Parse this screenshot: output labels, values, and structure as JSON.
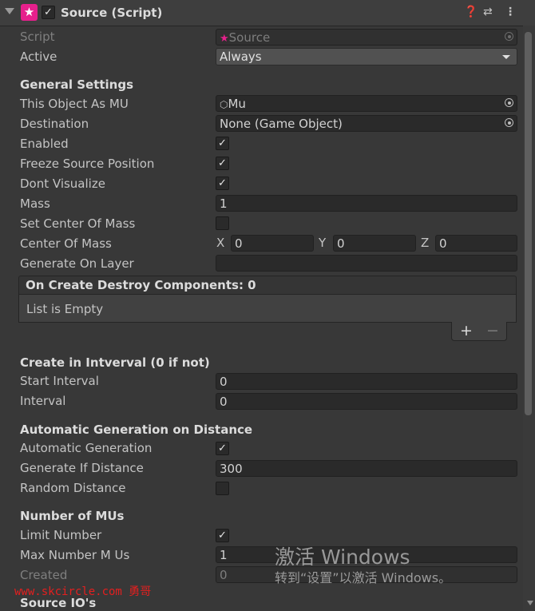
{
  "header": {
    "title": "Source (Script)",
    "enabled": true,
    "icons": [
      "help-icon",
      "preset-icon",
      "kebab-menu-icon"
    ]
  },
  "fields": {
    "script_label": "Script",
    "script_value": "Source",
    "active_label": "Active",
    "active_value": "Always",
    "general_settings": "General Settings",
    "this_object_label": "This Object As MU",
    "this_object_value": "Mu",
    "destination_label": "Destination",
    "destination_value": "None (Game Object)",
    "enabled_label": "Enabled",
    "enabled": true,
    "freeze_label": "Freeze Source Position",
    "freeze": true,
    "dont_visualize_label": "Dont Visualize",
    "dont_visualize": true,
    "mass_label": "Mass",
    "mass_value": "1",
    "set_com_label": "Set Center Of Mass",
    "set_com": false,
    "com_label": "Center Of Mass",
    "com_x_label": "X",
    "com_x": "0",
    "com_y_label": "Y",
    "com_y": "0",
    "com_z_label": "Z",
    "com_z": "0",
    "layer_label": "Generate On Layer",
    "layer_value": ""
  },
  "list": {
    "title": "On Create Destroy Components: 0",
    "empty": "List is Empty",
    "add": "+",
    "remove": "−"
  },
  "interval": {
    "section": "Create in Intverval (0 if not)",
    "start_label": "Start Interval",
    "start_value": "0",
    "interval_label": "Interval",
    "interval_value": "0"
  },
  "distance": {
    "section": "Automatic Generation on Distance",
    "auto_label": "Automatic Generation",
    "auto": true,
    "if_distance_label": "Generate If Distance",
    "if_distance_value": "300",
    "random_label": "Random Distance",
    "random": false
  },
  "mus": {
    "section": "Number of MUs",
    "limit_label": "Limit Number",
    "limit": true,
    "max_label": "Max Number M Us",
    "max_value": "1",
    "created_label": "Created",
    "created_value": "0"
  },
  "next_section": "Source IO's",
  "watermark": {
    "line1": "激活 Windows",
    "line2": "转到“设置”以激活 Windows。",
    "site": "www.skcircle.com 勇哥"
  },
  "colors": {
    "script_icon": "#e6208c",
    "background": "#383838",
    "field": "#2a2a2a"
  }
}
